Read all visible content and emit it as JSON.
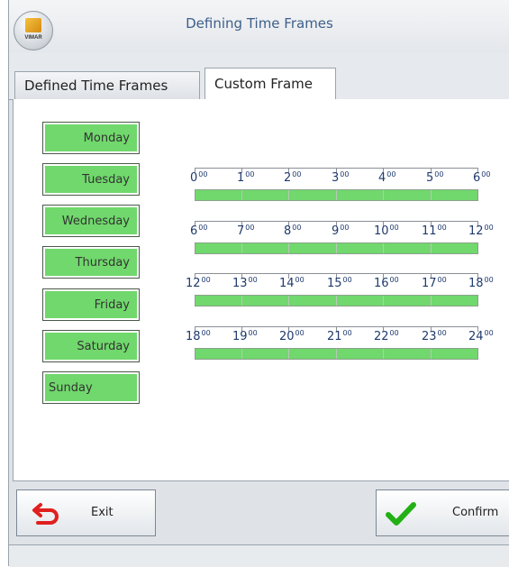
{
  "window": {
    "title": "Defining Time Frames",
    "logo_text": "VIMAR"
  },
  "tabs": [
    {
      "label": "Defined Time Frames",
      "active": false
    },
    {
      "label": "Custom Frame",
      "active": true
    }
  ],
  "days": [
    "Monday",
    "Tuesday",
    "Wednesday",
    "Thursday",
    "Friday",
    "Saturday",
    "Sunday"
  ],
  "timeline_rows": [
    {
      "ticks": [
        "0",
        "1",
        "2",
        "3",
        "4",
        "5",
        "6"
      ]
    },
    {
      "ticks": [
        "6",
        "7",
        "8",
        "9",
        "10",
        "11",
        "12"
      ]
    },
    {
      "ticks": [
        "12",
        "13",
        "14",
        "15",
        "16",
        "17",
        "18"
      ]
    },
    {
      "ticks": [
        "18",
        "19",
        "20",
        "21",
        "22",
        "23",
        "24"
      ]
    }
  ],
  "tick_minutes": "00",
  "buttons": {
    "exit_label": "Exit",
    "confirm_label": "Confirm"
  },
  "colors": {
    "active_green": "#70d86c",
    "exit_icon": "#e0201e",
    "confirm_icon": "#22b014"
  },
  "icons": {
    "exit": "back-arrow-icon",
    "confirm": "checkmark-icon"
  }
}
